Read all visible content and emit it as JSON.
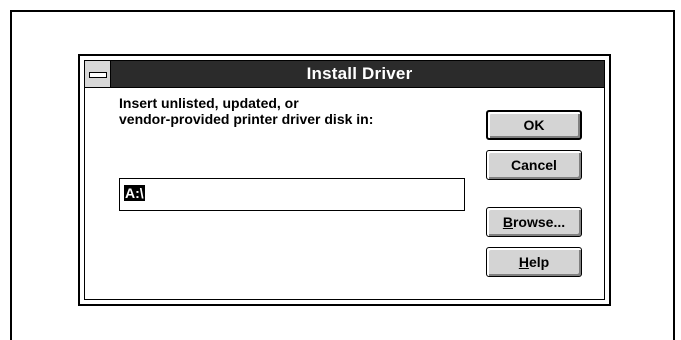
{
  "dialog": {
    "title": "Install Driver",
    "prompt_line1": "Insert unlisted, updated, or",
    "prompt_line2": "vendor-provided printer driver disk in:",
    "path_value": "A:\\",
    "sysmenu_icon": "system-menu-icon"
  },
  "buttons": {
    "ok": "OK",
    "cancel": "Cancel",
    "browse_mnemonic": "B",
    "browse_rest": "rowse...",
    "help_mnemonic": "H",
    "help_rest": "elp"
  },
  "colors": {
    "titlebar": "#2b2b2b",
    "button_face": "#d4d4d4",
    "background": "#ffffff"
  }
}
